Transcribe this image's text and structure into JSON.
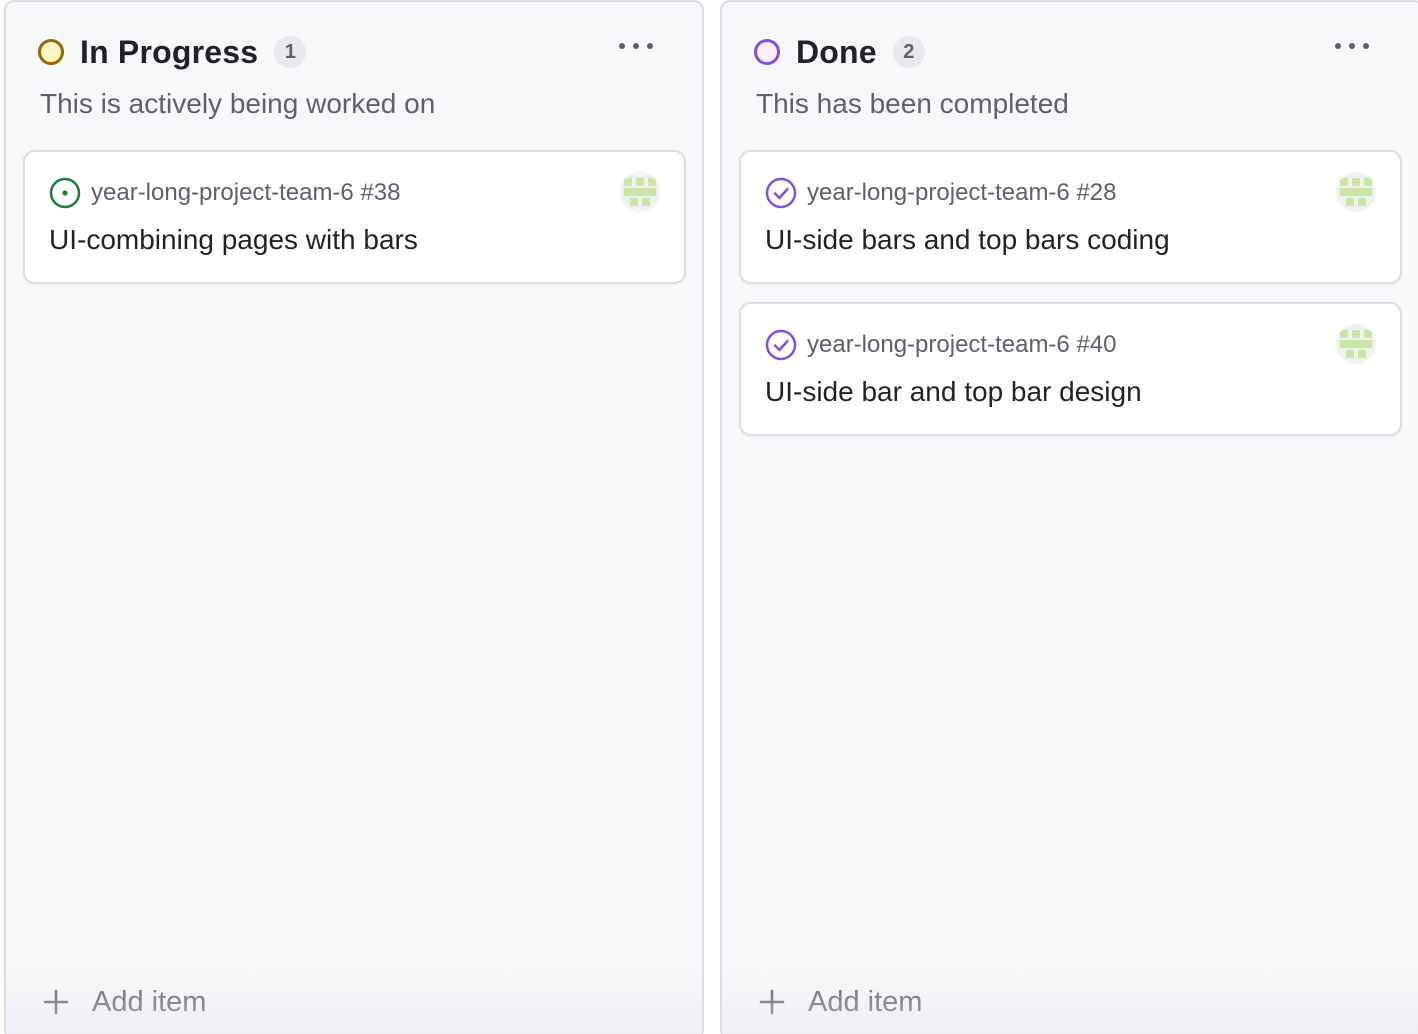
{
  "columns": [
    {
      "title": "In Progress",
      "count": "1",
      "description": "This is actively being worked on",
      "status_color": "#9a6700",
      "cards": [
        {
          "repo": "year-long-project-team-6 #38",
          "title": "UI-combining pages with bars",
          "state_icon": "issue-opened-icon",
          "state_color": "#1a7f37"
        }
      ],
      "add_item_label": "Add item"
    },
    {
      "title": "Done",
      "count": "2",
      "description": "This has been completed",
      "status_color": "#8250df",
      "cards": [
        {
          "repo": "year-long-project-team-6 #28",
          "title": "UI-side bars and top bars coding",
          "state_icon": "issue-closed-icon",
          "state_color": "#8250df"
        },
        {
          "repo": "year-long-project-team-6 #40",
          "title": "UI-side bar and top bar design",
          "state_icon": "issue-closed-icon",
          "state_color": "#8250df"
        }
      ],
      "add_item_label": "Add item"
    }
  ],
  "colors": {
    "avatar_pattern": "#c9e6a8",
    "text_primary": "#1f2328",
    "text_muted": "#59636e"
  }
}
